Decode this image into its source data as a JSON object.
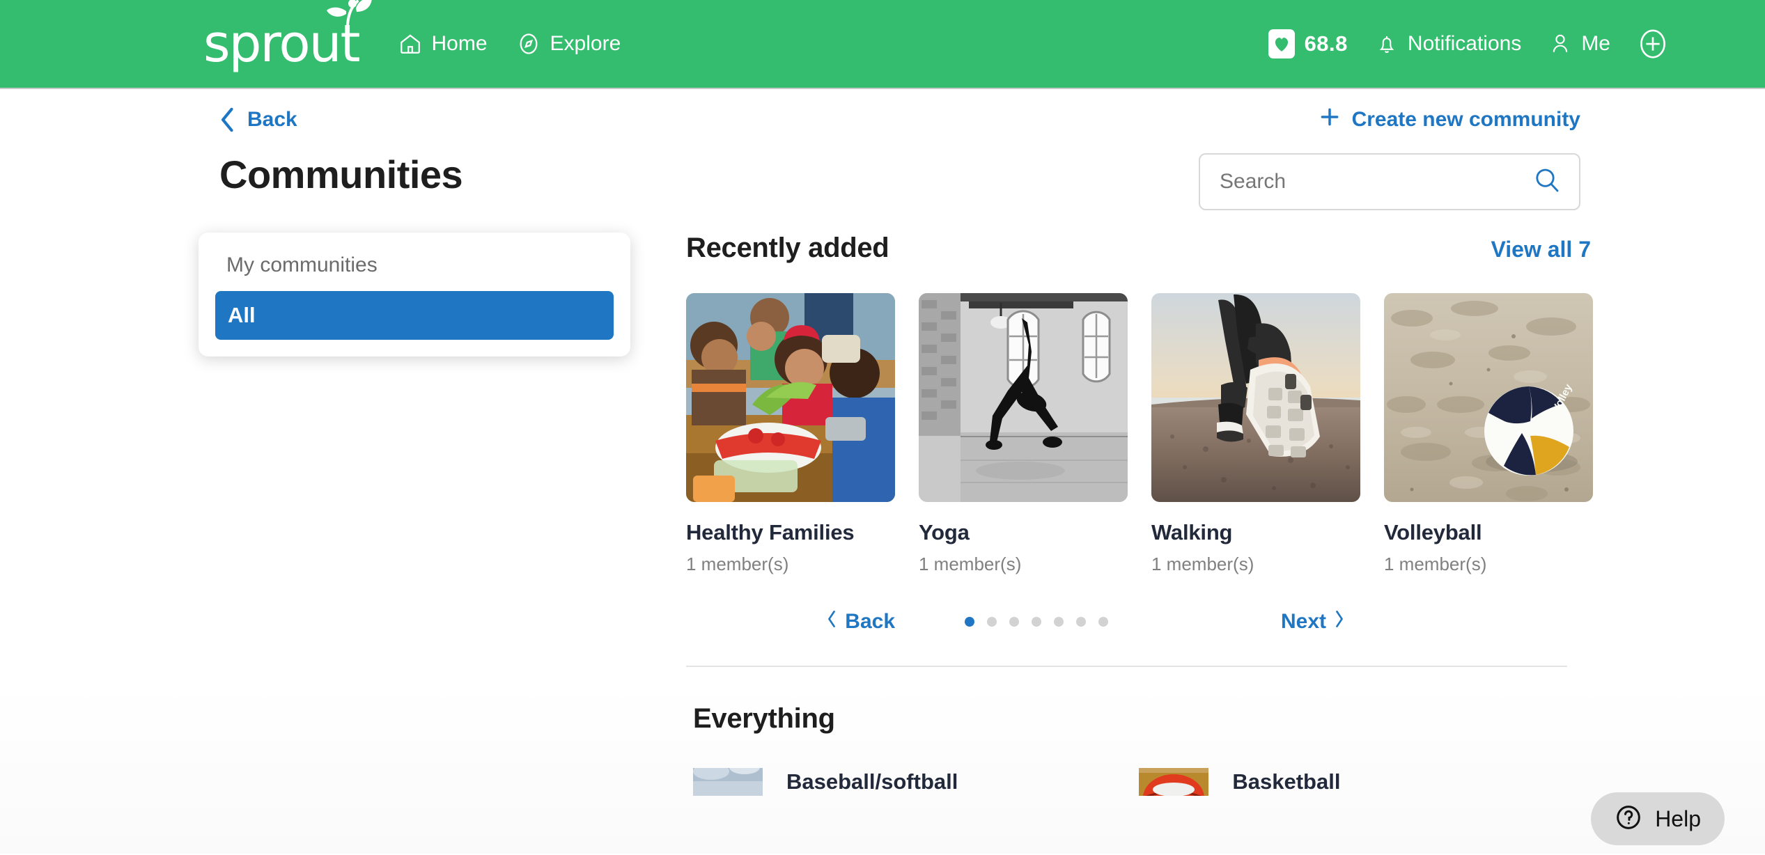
{
  "brand": {
    "name": "sprout",
    "color": "#34bd6e"
  },
  "header": {
    "nav": [
      {
        "label": "Home",
        "icon": "home-icon"
      },
      {
        "label": "Explore",
        "icon": "compass-icon"
      }
    ],
    "points": {
      "value": "68.8",
      "icon": "heart-icon"
    },
    "notifications": {
      "label": "Notifications",
      "icon": "bell-icon"
    },
    "me": {
      "label": "Me",
      "icon": "person-icon"
    },
    "add": {
      "icon": "plus-circle-icon"
    }
  },
  "toolbar": {
    "back_label": "Back",
    "create_label": "Create new community"
  },
  "page_title": "Communities",
  "search": {
    "value": "",
    "placeholder": "Search",
    "icon": "search-icon"
  },
  "filter_dropdown": {
    "label": "My communities",
    "options": [
      "All"
    ],
    "selected": "All"
  },
  "recently_added": {
    "title": "Recently added",
    "view_all_label": "View all 7",
    "cards": [
      {
        "title": "Healthy Families",
        "members": "1 member(s)"
      },
      {
        "title": "Yoga",
        "members": "1 member(s)"
      },
      {
        "title": "Walking",
        "members": "1 member(s)"
      },
      {
        "title": "Volleyball",
        "members": "1 member(s)"
      }
    ],
    "pager": {
      "back_label": "Back",
      "next_label": "Next",
      "total_dots": 7,
      "active_dot": 1
    }
  },
  "everything": {
    "title": "Everything",
    "items": [
      {
        "title": "Baseball/softball"
      },
      {
        "title": "Basketball"
      }
    ]
  },
  "help": {
    "label": "Help",
    "icon": "question-circle-icon"
  },
  "colors": {
    "brand_green": "#34bd6e",
    "link_blue": "#1f76c2",
    "text_dark": "#1e1e1e",
    "text_muted": "#808080"
  }
}
